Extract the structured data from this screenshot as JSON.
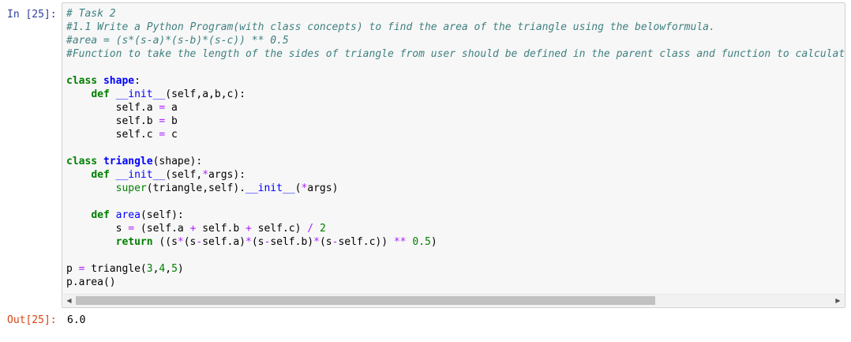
{
  "cell": {
    "in_prompt": "In [25]:",
    "out_prompt": "Out[25]:",
    "output_value": "6.0",
    "code_lines": [
      [
        {
          "t": "cm",
          "v": "# Task 2"
        }
      ],
      [
        {
          "t": "cm",
          "v": "#1.1 Write a Python Program(with class concepts) to find the area of the triangle using the belowformula."
        }
      ],
      [
        {
          "t": "cm",
          "v": "#area = (s*(s-a)*(s-b)*(s-c)) ** 0.5"
        }
      ],
      [
        {
          "t": "cm",
          "v": "#Function to take the length of the sides of triangle from user should be defined in the parent class and function to calculate t"
        }
      ],
      [],
      [
        {
          "t": "kw",
          "v": "class"
        },
        {
          "t": "nm",
          "v": " "
        },
        {
          "t": "cls",
          "v": "shape"
        },
        {
          "t": "nm",
          "v": ":"
        }
      ],
      [
        {
          "t": "nm",
          "v": "    "
        },
        {
          "t": "kw",
          "v": "def"
        },
        {
          "t": "nm",
          "v": " "
        },
        {
          "t": "fn",
          "v": "__init__"
        },
        {
          "t": "nm",
          "v": "(self,a,b,c):"
        }
      ],
      [
        {
          "t": "nm",
          "v": "        self.a "
        },
        {
          "t": "op",
          "v": "="
        },
        {
          "t": "nm",
          "v": " a"
        }
      ],
      [
        {
          "t": "nm",
          "v": "        self.b "
        },
        {
          "t": "op",
          "v": "="
        },
        {
          "t": "nm",
          "v": " b"
        }
      ],
      [
        {
          "t": "nm",
          "v": "        self.c "
        },
        {
          "t": "op",
          "v": "="
        },
        {
          "t": "nm",
          "v": " c"
        }
      ],
      [],
      [
        {
          "t": "kw",
          "v": "class"
        },
        {
          "t": "nm",
          "v": " "
        },
        {
          "t": "cls",
          "v": "triangle"
        },
        {
          "t": "nm",
          "v": "(shape):"
        }
      ],
      [
        {
          "t": "nm",
          "v": "    "
        },
        {
          "t": "kw",
          "v": "def"
        },
        {
          "t": "nm",
          "v": " "
        },
        {
          "t": "fn",
          "v": "__init__"
        },
        {
          "t": "nm",
          "v": "(self,"
        },
        {
          "t": "op",
          "v": "*"
        },
        {
          "t": "nm",
          "v": "args):"
        }
      ],
      [
        {
          "t": "nm",
          "v": "        "
        },
        {
          "t": "num",
          "v": "super"
        },
        {
          "t": "nm",
          "v": "(triangle,self)."
        },
        {
          "t": "fn",
          "v": "__init__"
        },
        {
          "t": "nm",
          "v": "("
        },
        {
          "t": "op",
          "v": "*"
        },
        {
          "t": "nm",
          "v": "args)"
        }
      ],
      [],
      [
        {
          "t": "nm",
          "v": "    "
        },
        {
          "t": "kw",
          "v": "def"
        },
        {
          "t": "nm",
          "v": " "
        },
        {
          "t": "fn",
          "v": "area"
        },
        {
          "t": "nm",
          "v": "(self):"
        }
      ],
      [
        {
          "t": "nm",
          "v": "        s "
        },
        {
          "t": "op",
          "v": "="
        },
        {
          "t": "nm",
          "v": " (self.a "
        },
        {
          "t": "op",
          "v": "+"
        },
        {
          "t": "nm",
          "v": " self.b "
        },
        {
          "t": "op",
          "v": "+"
        },
        {
          "t": "nm",
          "v": " self.c) "
        },
        {
          "t": "op",
          "v": "/"
        },
        {
          "t": "nm",
          "v": " "
        },
        {
          "t": "num",
          "v": "2"
        }
      ],
      [
        {
          "t": "nm",
          "v": "        "
        },
        {
          "t": "kw",
          "v": "return"
        },
        {
          "t": "nm",
          "v": " ((s"
        },
        {
          "t": "op",
          "v": "*"
        },
        {
          "t": "nm",
          "v": "(s"
        },
        {
          "t": "op",
          "v": "-"
        },
        {
          "t": "nm",
          "v": "self.a)"
        },
        {
          "t": "op",
          "v": "*"
        },
        {
          "t": "nm",
          "v": "(s"
        },
        {
          "t": "op",
          "v": "-"
        },
        {
          "t": "nm",
          "v": "self.b)"
        },
        {
          "t": "op",
          "v": "*"
        },
        {
          "t": "nm",
          "v": "(s"
        },
        {
          "t": "op",
          "v": "-"
        },
        {
          "t": "nm",
          "v": "self.c)) "
        },
        {
          "t": "op",
          "v": "**"
        },
        {
          "t": "nm",
          "v": " "
        },
        {
          "t": "num",
          "v": "0.5"
        },
        {
          "t": "nm",
          "v": ")"
        }
      ],
      [],
      [
        {
          "t": "nm",
          "v": "p "
        },
        {
          "t": "op",
          "v": "="
        },
        {
          "t": "nm",
          "v": " triangle("
        },
        {
          "t": "num",
          "v": "3"
        },
        {
          "t": "nm",
          "v": ","
        },
        {
          "t": "num",
          "v": "4"
        },
        {
          "t": "nm",
          "v": ","
        },
        {
          "t": "num",
          "v": "5"
        },
        {
          "t": "nm",
          "v": ")"
        }
      ],
      [
        {
          "t": "nm",
          "v": "p.area()"
        }
      ]
    ],
    "scroll_left_icon": "◀",
    "scroll_right_icon": "▶"
  },
  "colors": {
    "in_prompt": "#303f9f",
    "out_prompt": "#d84315",
    "comment": "#408080",
    "keyword": "#008000",
    "class_name": "#0000ff",
    "operator": "#aa22ff",
    "cell_background": "#f7f7f7"
  }
}
